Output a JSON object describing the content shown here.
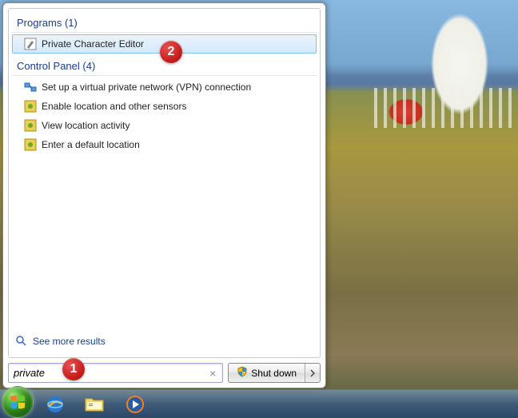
{
  "sections": {
    "programs": {
      "header": "Programs (1)"
    },
    "control_panel": {
      "header": "Control Panel (4)"
    }
  },
  "results": {
    "program_item": "Private Character Editor",
    "cp1": "Set up a virtual private network (VPN) connection",
    "cp2": "Enable location and other sensors",
    "cp3": "View location activity",
    "cp4": "Enter a default location"
  },
  "see_more": "See more results",
  "search": {
    "value": "private"
  },
  "shutdown": {
    "label": "Shut down"
  },
  "annotations": {
    "b1": "1",
    "b2": "2"
  }
}
